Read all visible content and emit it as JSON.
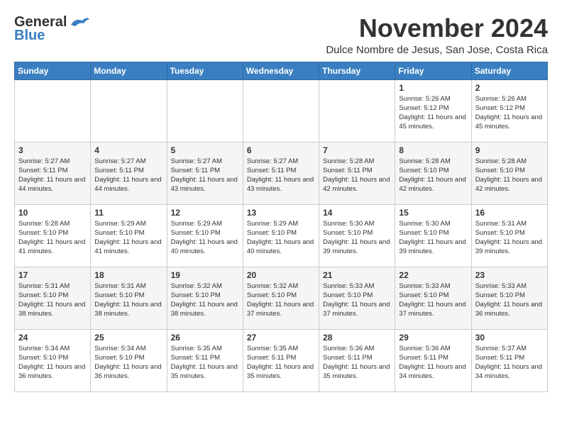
{
  "logo": {
    "line1": "General",
    "line2": "Blue"
  },
  "header": {
    "month_title": "November 2024",
    "subtitle": "Dulce Nombre de Jesus, San Jose, Costa Rica"
  },
  "weekdays": [
    "Sunday",
    "Monday",
    "Tuesday",
    "Wednesday",
    "Thursday",
    "Friday",
    "Saturday"
  ],
  "weeks": [
    [
      {
        "day": "",
        "info": ""
      },
      {
        "day": "",
        "info": ""
      },
      {
        "day": "",
        "info": ""
      },
      {
        "day": "",
        "info": ""
      },
      {
        "day": "",
        "info": ""
      },
      {
        "day": "1",
        "info": "Sunrise: 5:26 AM\nSunset: 5:12 PM\nDaylight: 11 hours and 45 minutes."
      },
      {
        "day": "2",
        "info": "Sunrise: 5:26 AM\nSunset: 5:12 PM\nDaylight: 11 hours and 45 minutes."
      }
    ],
    [
      {
        "day": "3",
        "info": "Sunrise: 5:27 AM\nSunset: 5:11 PM\nDaylight: 11 hours and 44 minutes."
      },
      {
        "day": "4",
        "info": "Sunrise: 5:27 AM\nSunset: 5:11 PM\nDaylight: 11 hours and 44 minutes."
      },
      {
        "day": "5",
        "info": "Sunrise: 5:27 AM\nSunset: 5:11 PM\nDaylight: 11 hours and 43 minutes."
      },
      {
        "day": "6",
        "info": "Sunrise: 5:27 AM\nSunset: 5:11 PM\nDaylight: 11 hours and 43 minutes."
      },
      {
        "day": "7",
        "info": "Sunrise: 5:28 AM\nSunset: 5:11 PM\nDaylight: 11 hours and 42 minutes."
      },
      {
        "day": "8",
        "info": "Sunrise: 5:28 AM\nSunset: 5:10 PM\nDaylight: 11 hours and 42 minutes."
      },
      {
        "day": "9",
        "info": "Sunrise: 5:28 AM\nSunset: 5:10 PM\nDaylight: 11 hours and 42 minutes."
      }
    ],
    [
      {
        "day": "10",
        "info": "Sunrise: 5:28 AM\nSunset: 5:10 PM\nDaylight: 11 hours and 41 minutes."
      },
      {
        "day": "11",
        "info": "Sunrise: 5:29 AM\nSunset: 5:10 PM\nDaylight: 11 hours and 41 minutes."
      },
      {
        "day": "12",
        "info": "Sunrise: 5:29 AM\nSunset: 5:10 PM\nDaylight: 11 hours and 40 minutes."
      },
      {
        "day": "13",
        "info": "Sunrise: 5:29 AM\nSunset: 5:10 PM\nDaylight: 11 hours and 40 minutes."
      },
      {
        "day": "14",
        "info": "Sunrise: 5:30 AM\nSunset: 5:10 PM\nDaylight: 11 hours and 39 minutes."
      },
      {
        "day": "15",
        "info": "Sunrise: 5:30 AM\nSunset: 5:10 PM\nDaylight: 11 hours and 39 minutes."
      },
      {
        "day": "16",
        "info": "Sunrise: 5:31 AM\nSunset: 5:10 PM\nDaylight: 11 hours and 39 minutes."
      }
    ],
    [
      {
        "day": "17",
        "info": "Sunrise: 5:31 AM\nSunset: 5:10 PM\nDaylight: 11 hours and 38 minutes."
      },
      {
        "day": "18",
        "info": "Sunrise: 5:31 AM\nSunset: 5:10 PM\nDaylight: 11 hours and 38 minutes."
      },
      {
        "day": "19",
        "info": "Sunrise: 5:32 AM\nSunset: 5:10 PM\nDaylight: 11 hours and 38 minutes."
      },
      {
        "day": "20",
        "info": "Sunrise: 5:32 AM\nSunset: 5:10 PM\nDaylight: 11 hours and 37 minutes."
      },
      {
        "day": "21",
        "info": "Sunrise: 5:33 AM\nSunset: 5:10 PM\nDaylight: 11 hours and 37 minutes."
      },
      {
        "day": "22",
        "info": "Sunrise: 5:33 AM\nSunset: 5:10 PM\nDaylight: 11 hours and 37 minutes."
      },
      {
        "day": "23",
        "info": "Sunrise: 5:33 AM\nSunset: 5:10 PM\nDaylight: 11 hours and 36 minutes."
      }
    ],
    [
      {
        "day": "24",
        "info": "Sunrise: 5:34 AM\nSunset: 5:10 PM\nDaylight: 11 hours and 36 minutes."
      },
      {
        "day": "25",
        "info": "Sunrise: 5:34 AM\nSunset: 5:10 PM\nDaylight: 11 hours and 36 minutes."
      },
      {
        "day": "26",
        "info": "Sunrise: 5:35 AM\nSunset: 5:11 PM\nDaylight: 11 hours and 35 minutes."
      },
      {
        "day": "27",
        "info": "Sunrise: 5:35 AM\nSunset: 5:11 PM\nDaylight: 11 hours and 35 minutes."
      },
      {
        "day": "28",
        "info": "Sunrise: 5:36 AM\nSunset: 5:11 PM\nDaylight: 11 hours and 35 minutes."
      },
      {
        "day": "29",
        "info": "Sunrise: 5:36 AM\nSunset: 5:11 PM\nDaylight: 11 hours and 34 minutes."
      },
      {
        "day": "30",
        "info": "Sunrise: 5:37 AM\nSunset: 5:11 PM\nDaylight: 11 hours and 34 minutes."
      }
    ]
  ]
}
